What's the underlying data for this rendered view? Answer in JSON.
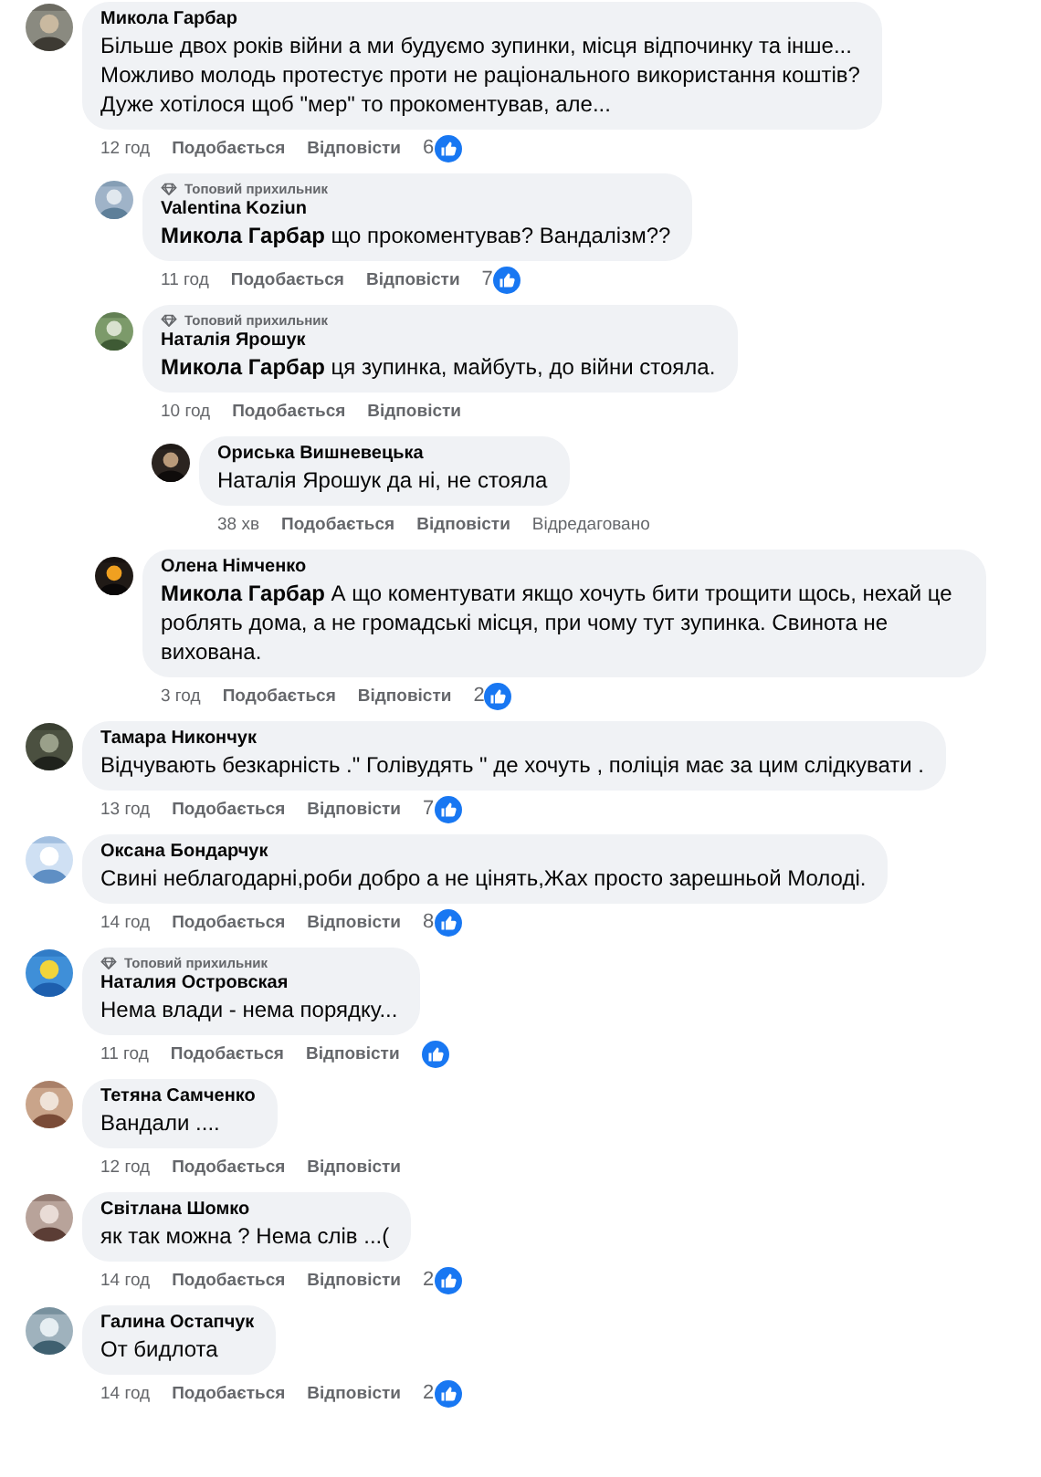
{
  "comments": [
    {
      "author": "Микола Гарбар",
      "text": "Більше двох років війни а ми будуємо зупинки, місця відпочинку та інше...\nМожливо молодь протестує проти не раціонального використання коштів?\nДуже хотілося щоб \"мер\" то прокоментував, але...",
      "time": "12 год",
      "like": "Подобається",
      "reply": "Відповісти",
      "reactions": "6",
      "reacted": true,
      "replies": [
        {
          "badge": "Топовий прихильник",
          "author": "Valentina Koziun",
          "text": "**Микола Гарбар** що прокоментував? Вандалізм??",
          "time": "11 год",
          "like": "Подобається",
          "reply": "Відповісти",
          "reactions": "7",
          "reacted": true
        },
        {
          "badge": "Топовий прихильник",
          "author": "Наталія Ярошук",
          "text": "**Микола Гарбар** ця зупинка, майбуть, до війни стояла.",
          "time": "10 год",
          "like": "Подобається",
          "reply": "Відповісти",
          "reacted": false,
          "replies": [
            {
              "author": "Ориська Вишневецька",
              "text": "Наталія Ярошук да ні, не стояла",
              "time": "38 хв",
              "like": "Подобається",
              "reply": "Відповісти",
              "edited": "Відредаговано",
              "reacted": false
            }
          ]
        },
        {
          "author": "Олена Німченко",
          "text": "**Микола Гарбар** А що коментувати якщо хочуть бити трощити щось, нехай це роблять дома, а не громадські місця, при чому тут зупинка. Свинота не вихована.",
          "time": "3 год",
          "like": "Подобається",
          "reply": "Відповісти",
          "reactions": "2",
          "reacted": true
        }
      ]
    },
    {
      "author": "Тамара Никончук",
      "text": "Відчувають безкарність .\" Голівудять \" де хочуть , поліція має за цим слідкувати .",
      "time": "13 год",
      "like": "Подобається",
      "reply": "Відповісти",
      "reactions": "7",
      "reacted": true
    },
    {
      "author": "Оксана Бондарчук",
      "text": "Свині неблагодарні,роби добро а не цінять,Жах просто зарешньой Молоді.",
      "time": "14 год",
      "like": "Подобається",
      "reply": "Відповісти",
      "reactions": "8",
      "reacted": true
    },
    {
      "badge": "Топовий прихильник",
      "author": "Наталия Островская",
      "text": "Нема влади - нема порядку...",
      "time": "11 год",
      "like": "Подобається",
      "reply": "Відповісти",
      "reacted": true
    },
    {
      "author": "Тетяна Самченко",
      "text": "Вандали ....",
      "time": "12 год",
      "like": "Подобається",
      "reply": "Відповісти",
      "reacted": false
    },
    {
      "author": "Світлана Шомко",
      "text": "як так можна ? Нема слів ...(",
      "time": "14 год",
      "like": "Подобається",
      "reply": "Відповісти",
      "reactions": "2",
      "reacted": true
    },
    {
      "author": "Галина Остапчук",
      "text": "От бидлота",
      "time": "14 год",
      "like": "Подобається",
      "reply": "Відповісти",
      "reactions": "2",
      "reacted": true
    }
  ]
}
